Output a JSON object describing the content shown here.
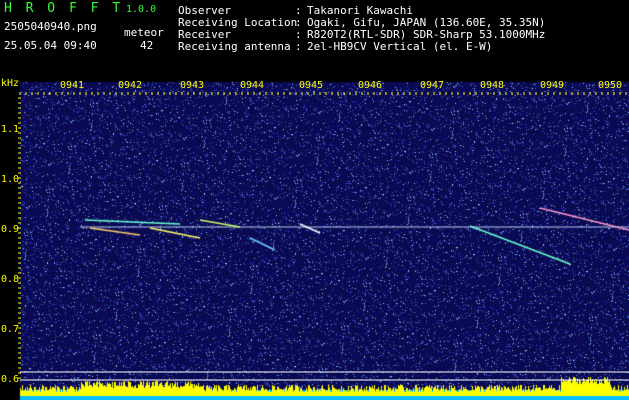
{
  "app": {
    "name": "H R O F F T",
    "version": "1.0.0"
  },
  "file": {
    "name": "2505040940.png",
    "timestamp": "25.05.04 09:40"
  },
  "counter": {
    "label": "meteor",
    "value": "42"
  },
  "info": [
    {
      "key": "Observer",
      "sep": ":",
      "value": "Takanori Kawachi"
    },
    {
      "key": "Receiving Location",
      "sep": ":",
      "value": "Ogaki, Gifu, JAPAN (136.60E, 35.35N)"
    },
    {
      "key": "Receiver",
      "sep": ":",
      "value": "R820T2(RTL-SDR) SDR-Sharp 53.1000MHz"
    },
    {
      "key": "Receiving antenna",
      "sep": ":",
      "value": "2el-HB9CV Vertical (el. E-W)"
    }
  ],
  "axis": {
    "unit": "kHz",
    "time_ticks": [
      "0941",
      "0942",
      "0943",
      "0944",
      "0945",
      "0946",
      "0947",
      "0948",
      "0949",
      "0950"
    ],
    "freq_ticks": [
      "1.1",
      "1.0",
      "0.9",
      "0.8",
      "0.7",
      "0.6"
    ]
  },
  "colors": {
    "background": "#0a0a55",
    "accent": "#ffff00",
    "header_text": "#ffffff",
    "title": "#33ff33"
  }
}
